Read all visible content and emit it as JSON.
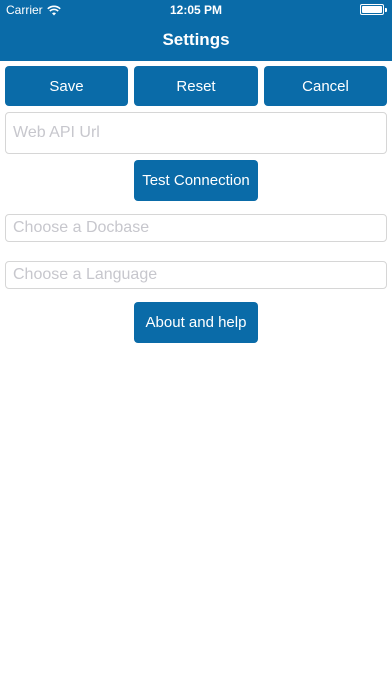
{
  "status": {
    "carrier": "Carrier",
    "time": "12:05 PM"
  },
  "nav": {
    "title": "Settings"
  },
  "toolbar": {
    "save_label": "Save",
    "reset_label": "Reset",
    "cancel_label": "Cancel"
  },
  "form": {
    "web_api_url_placeholder": "Web API Url",
    "test_connection_label": "Test Connection",
    "docbase_placeholder": "Choose a Docbase",
    "language_placeholder": "Choose a Language",
    "about_help_label": "About and help"
  },
  "colors": {
    "accent": "#0a6ba8",
    "placeholder": "#c7c7cd",
    "border": "#d6d6d6"
  },
  "icons": [
    "wifi-icon",
    "battery-icon"
  ]
}
